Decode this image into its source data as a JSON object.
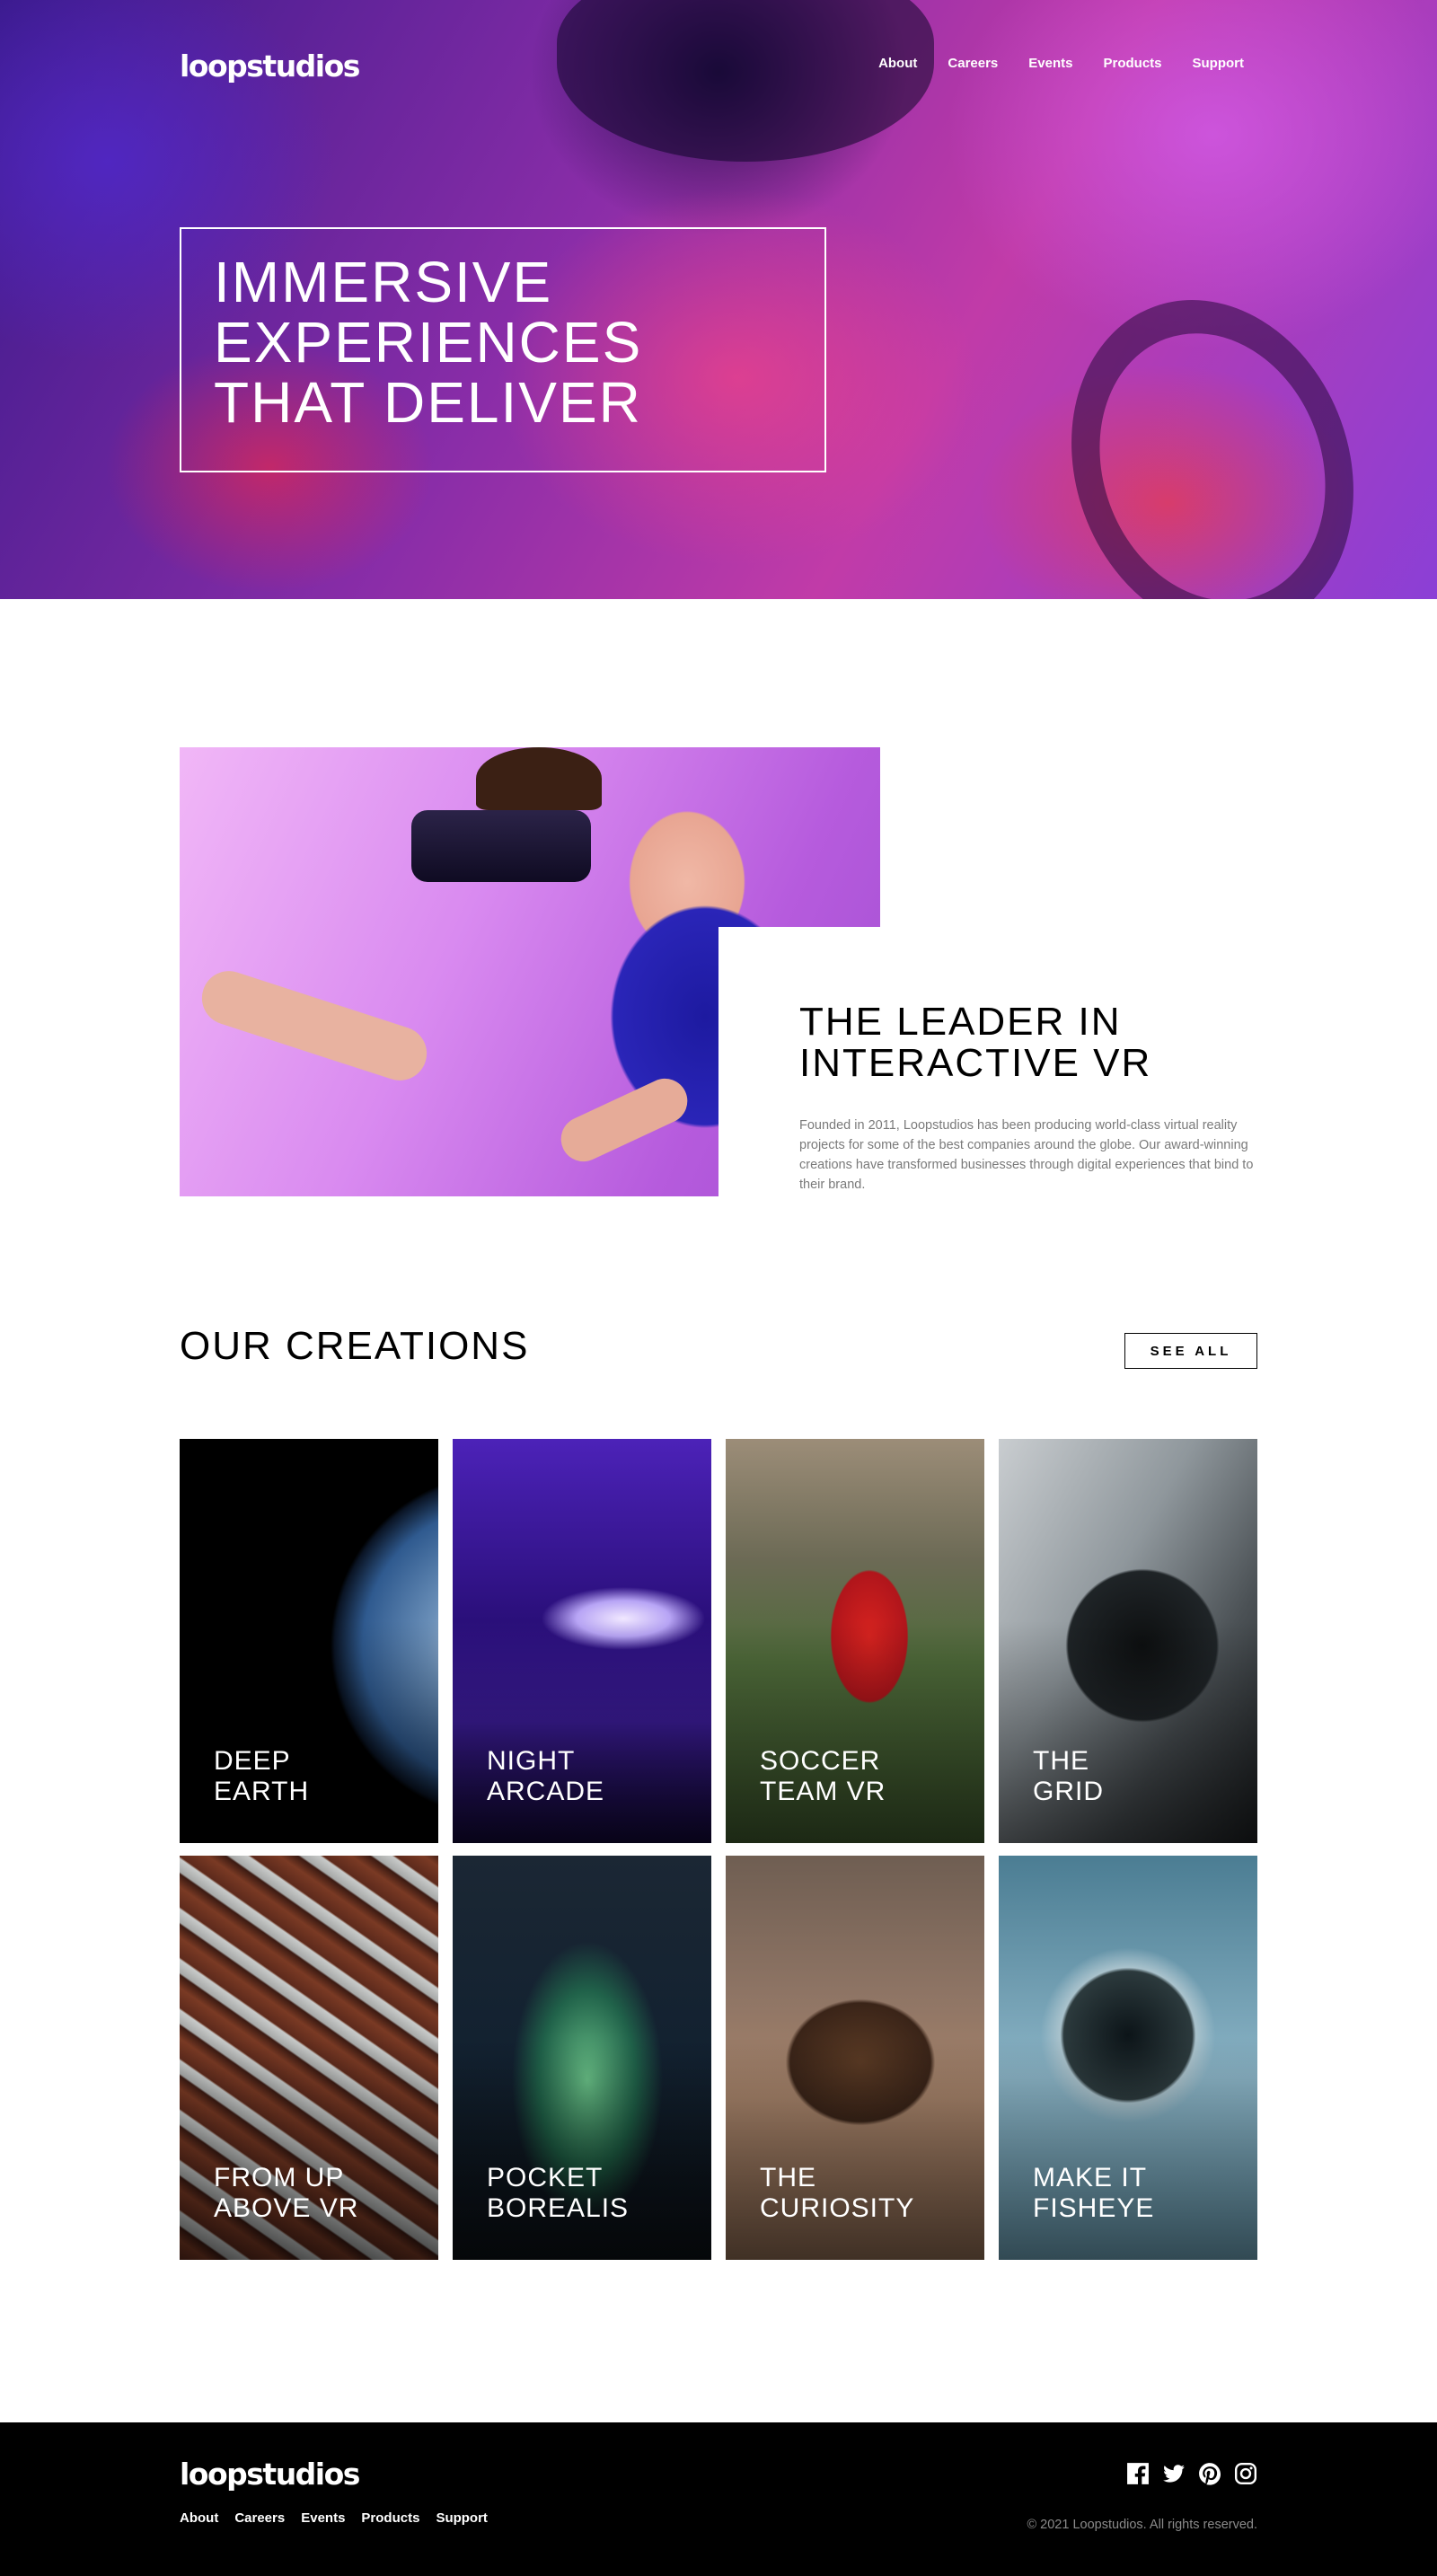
{
  "brand": "loopstudios",
  "nav": [
    "About",
    "Careers",
    "Events",
    "Products",
    "Support"
  ],
  "hero": {
    "title": "IMMERSIVE\nEXPERIENCES\nTHAT DELIVER"
  },
  "intro": {
    "title": "THE LEADER IN\nINTERACTIVE VR",
    "text": "Founded in 2011, Loopstudios has been producing world-class virtual reality projects for some of the best companies around the globe. Our award-winning creations have transformed businesses through digital experiences that bind to their brand."
  },
  "creations": {
    "title": "OUR CREATIONS",
    "see_all": "SEE ALL",
    "items": [
      {
        "label": "DEEP\nEARTH"
      },
      {
        "label": "NIGHT\nARCADE"
      },
      {
        "label": "SOCCER\nTEAM VR"
      },
      {
        "label": "THE\nGRID"
      },
      {
        "label": "FROM UP\nABOVE VR"
      },
      {
        "label": "POCKET\nBOREALIS"
      },
      {
        "label": "THE\nCURIOSITY"
      },
      {
        "label": "MAKE IT\nFISHEYE"
      }
    ]
  },
  "footer": {
    "social_icons": [
      "facebook-icon",
      "twitter-icon",
      "pinterest-icon",
      "instagram-icon"
    ],
    "copyright": "© 2021 Loopstudios. All rights reserved."
  }
}
